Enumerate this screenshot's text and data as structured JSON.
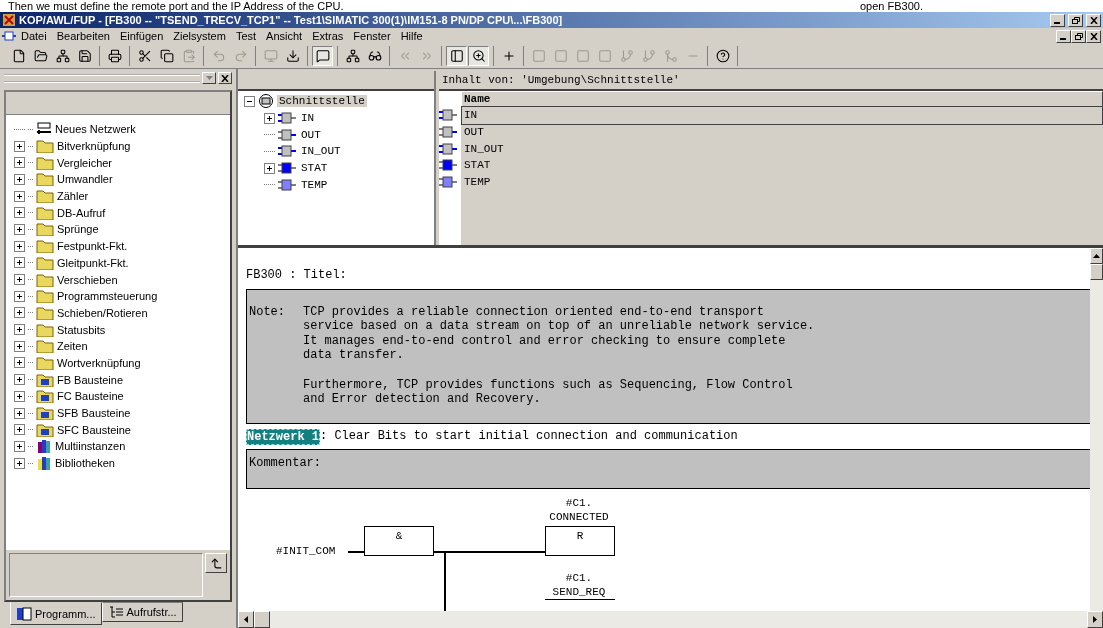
{
  "caption": {
    "left": "Then we must define the remote port and the IP Address of the CPU.",
    "right": "open FB300."
  },
  "window": {
    "title": "KOP/AWL/FUP  - [FB300 -- \"TSEND_TRECV_TCP1\" -- Test1\\SIMATIC 300(1)\\IM151-8 PN/DP CPU\\...\\FB300]"
  },
  "menu": [
    "Datei",
    "Bearbeiten",
    "Einfügen",
    "Zielsystem",
    "Test",
    "Ansicht",
    "Extras",
    "Fenster",
    "Hilfe"
  ],
  "toolbar": {
    "groups": [
      [
        {
          "kind": "new",
          "pressed": false,
          "disabled": false
        },
        {
          "kind": "open",
          "pressed": false,
          "disabled": false
        },
        {
          "kind": "nodes",
          "pressed": false,
          "disabled": false
        },
        {
          "kind": "save",
          "pressed": false,
          "disabled": false
        }
      ],
      [
        {
          "kind": "print",
          "pressed": false,
          "disabled": false
        }
      ],
      [
        {
          "kind": "cut",
          "pressed": false,
          "disabled": false
        },
        {
          "kind": "copy",
          "pressed": false,
          "disabled": false
        },
        {
          "kind": "paste",
          "pressed": false,
          "disabled": true
        }
      ],
      [
        {
          "kind": "undo",
          "pressed": false,
          "disabled": true
        },
        {
          "kind": "redo",
          "pressed": false,
          "disabled": true
        }
      ],
      [
        {
          "kind": "monitor",
          "pressed": false,
          "disabled": true
        },
        {
          "kind": "download",
          "pressed": false,
          "disabled": false
        }
      ],
      [
        {
          "kind": "overview",
          "pressed": true,
          "disabled": false
        }
      ],
      [
        {
          "kind": "network",
          "pressed": false,
          "disabled": false
        },
        {
          "kind": "glasses",
          "pressed": false,
          "disabled": false
        }
      ],
      [
        {
          "kind": "previous",
          "pressed": false,
          "disabled": true
        },
        {
          "kind": "next",
          "pressed": false,
          "disabled": true
        }
      ],
      [
        {
          "kind": "panel",
          "pressed": true,
          "disabled": false
        },
        {
          "kind": "zoom",
          "pressed": true,
          "disabled": false
        }
      ],
      [
        {
          "kind": "new_network",
          "pressed": false,
          "disabled": false
        }
      ],
      [
        {
          "kind": "and",
          "pressed": false,
          "disabled": true
        },
        {
          "kind": "or",
          "pressed": false,
          "disabled": true
        },
        {
          "kind": "assign",
          "pressed": false,
          "disabled": true
        },
        {
          "kind": "empty_box",
          "pressed": false,
          "disabled": true
        },
        {
          "kind": "branch",
          "pressed": false,
          "disabled": true
        },
        {
          "kind": "open_branch",
          "pressed": false,
          "disabled": true
        },
        {
          "kind": "close_branch",
          "pressed": false,
          "disabled": true
        },
        {
          "kind": "connection",
          "pressed": false,
          "disabled": true
        }
      ],
      [
        {
          "kind": "help",
          "pressed": false,
          "disabled": false
        }
      ]
    ]
  },
  "catalog": {
    "items": [
      {
        "label": "Neues Netzwerk",
        "kind": "network",
        "expandable": false
      },
      {
        "label": "Bitverknüpfung",
        "kind": "folder",
        "expandable": true
      },
      {
        "label": "Vergleicher",
        "kind": "folder",
        "expandable": true
      },
      {
        "label": "Umwandler",
        "kind": "folder",
        "expandable": true
      },
      {
        "label": "Zähler",
        "kind": "folder",
        "expandable": true
      },
      {
        "label": "DB-Aufruf",
        "kind": "folder",
        "expandable": true
      },
      {
        "label": "Sprünge",
        "kind": "folder",
        "expandable": true
      },
      {
        "label": "Festpunkt-Fkt.",
        "kind": "folder",
        "expandable": true
      },
      {
        "label": "Gleitpunkt-Fkt.",
        "kind": "folder",
        "expandable": true
      },
      {
        "label": "Verschieben",
        "kind": "folder",
        "expandable": true
      },
      {
        "label": "Programmsteuerung",
        "kind": "folder",
        "expandable": true
      },
      {
        "label": "Schieben/Rotieren",
        "kind": "folder",
        "expandable": true
      },
      {
        "label": "Statusbits",
        "kind": "folder",
        "expandable": true
      },
      {
        "label": "Zeiten",
        "kind": "folder",
        "expandable": true
      },
      {
        "label": "Wortverknüpfung",
        "kind": "folder",
        "expandable": true
      },
      {
        "label": "FB Bausteine",
        "kind": "blocks",
        "expandable": true
      },
      {
        "label": "FC Bausteine",
        "kind": "blocks",
        "expandable": true
      },
      {
        "label": "SFB Bausteine",
        "kind": "blocks",
        "expandable": true
      },
      {
        "label": "SFC Bausteine",
        "kind": "blocks",
        "expandable": true
      },
      {
        "label": "Multiinstanzen",
        "kind": "books",
        "expandable": true
      },
      {
        "label": "Bibliotheken",
        "kind": "library",
        "expandable": true
      }
    ],
    "tabs": [
      {
        "label": "Programm...",
        "selected": true
      },
      {
        "label": "Aufrufstr...",
        "selected": false
      }
    ]
  },
  "interface": {
    "root": {
      "label": "Schnittstelle",
      "expanded": true,
      "selected": true,
      "children": [
        {
          "label": "IN",
          "kind": "in",
          "expandable": true,
          "selected": false
        },
        {
          "label": "OUT",
          "kind": "out",
          "expandable": false,
          "selected": false
        },
        {
          "label": "IN_OUT",
          "kind": "in_out",
          "expandable": false,
          "selected": false
        },
        {
          "label": "STAT",
          "kind": "stat",
          "expandable": true,
          "selected": false
        },
        {
          "label": "TEMP",
          "kind": "temp",
          "expandable": false,
          "selected": false
        }
      ]
    },
    "content_header": "Inhalt von: 'Umgebung\\Schnittstelle'",
    "column": "Name",
    "rows": [
      {
        "name": "IN",
        "kind": "in",
        "selected": true
      },
      {
        "name": "OUT",
        "kind": "out",
        "selected": false
      },
      {
        "name": "IN_OUT",
        "kind": "in_out",
        "selected": false
      },
      {
        "name": "STAT",
        "kind": "stat",
        "selected": false
      },
      {
        "name": "TEMP",
        "kind": "temp",
        "selected": false
      }
    ]
  },
  "editor": {
    "block_title": "FB300 : Titel:",
    "note_label": "Note:",
    "note": "TCP provides a reliable connection oriented end-to-end transport\nservice based on a data stream on top of an unreliable network service.\nIt manages end-to-end control and error checking to ensure complete\ndata transfer.\n\nFurthermore, TCP provides functions such as Sequencing, Flow Control\nand Error detection and Recovery.",
    "network": {
      "label": "Netzwerk 1",
      "title": ": Clear Bits to start initial connection and communication",
      "comment": "Kommentar:"
    },
    "diagram": {
      "input": "#INIT_COM",
      "gate": "&",
      "coil1_lines": [
        "#C1.",
        "CONNECTED"
      ],
      "coil1": "R",
      "coil2_lines": [
        "#C1.",
        "SEND_REQ"
      ]
    }
  }
}
